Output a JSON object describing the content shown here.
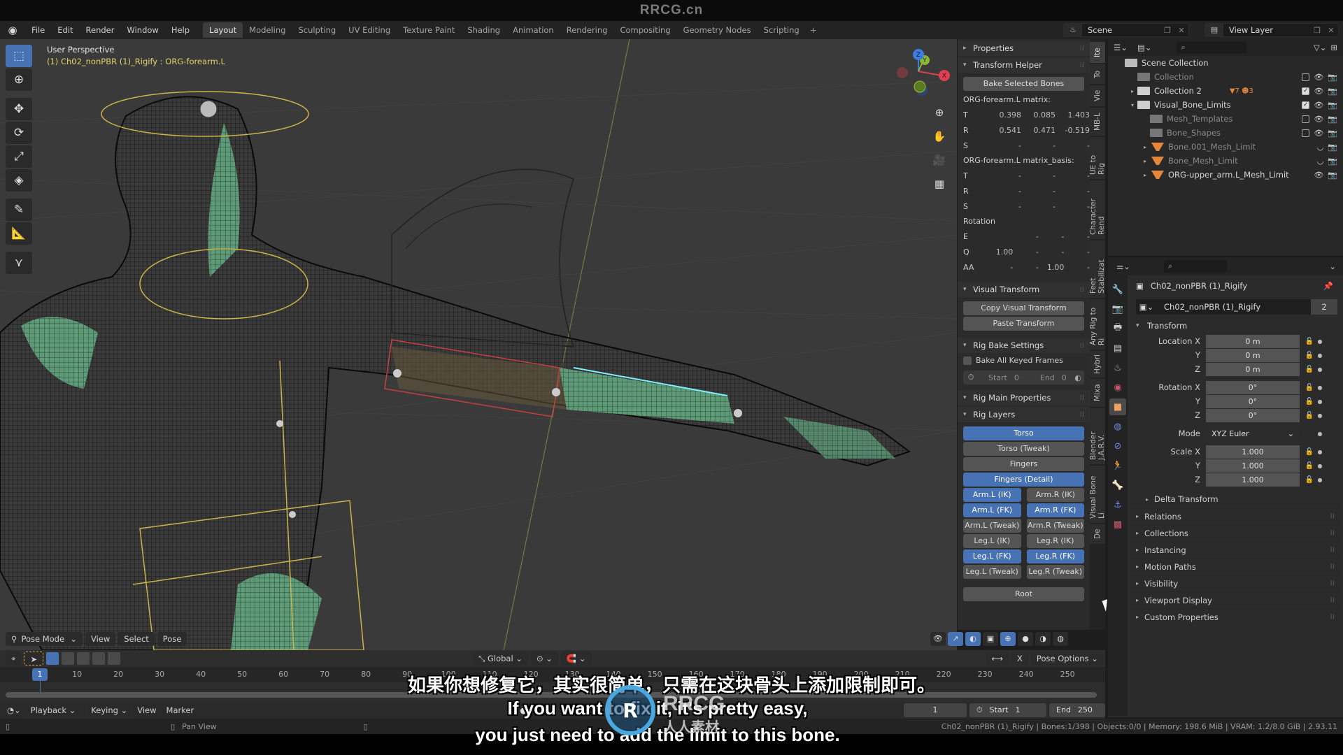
{
  "window": {
    "title": "RRCG.cn"
  },
  "menu": {
    "items": [
      "File",
      "Edit",
      "Render",
      "Window",
      "Help"
    ]
  },
  "workspaces": {
    "tabs": [
      "Layout",
      "Modeling",
      "Sculpting",
      "UV Editing",
      "Texture Paint",
      "Shading",
      "Animation",
      "Rendering",
      "Compositing",
      "Geometry Nodes",
      "Scripting"
    ],
    "active": "Layout",
    "add": "+"
  },
  "scene": {
    "name": "Scene",
    "view_layer": "View Layer"
  },
  "viewport": {
    "perspective": "User Perspective",
    "active_info": "(1) Ch02_nonPBR (1)_Rigify : ORG-forearm.L",
    "gizmo": {
      "x": "X",
      "y": "Y",
      "z": "Z",
      "colors": {
        "x": "#e0404f",
        "y": "#8ab835",
        "z": "#3d7fe0"
      }
    },
    "nav_buttons": [
      "zoom-icon",
      "hand-icon",
      "camera-icon",
      "grid-icon"
    ],
    "tools": [
      "select-box",
      "cursor",
      "move",
      "rotate",
      "scale",
      "transform",
      "annotate",
      "measure",
      "bone-roll"
    ],
    "header": {
      "mode": "Pose Mode",
      "menus": [
        "View",
        "Select",
        "Pose"
      ]
    },
    "toolbar": {
      "orientation": "Global",
      "pose_options": "Pose Options",
      "mirror_axis": "X"
    }
  },
  "npanel": {
    "sections": {
      "properties": "Properties",
      "transform_helper": "Transform Helper",
      "visual_transform": "Visual Transform",
      "rig_bake_settings": "Rig Bake Settings",
      "rig_main_properties": "Rig Main Properties",
      "rig_layers": "Rig Layers"
    },
    "bake_selected_bones": "Bake Selected Bones",
    "matrix_label": "ORG-forearm.L matrix:",
    "matrix": [
      {
        "k": "T",
        "v": [
          "0.398",
          "0.085",
          "1.403"
        ]
      },
      {
        "k": "R",
        "v": [
          "0.541",
          "0.471",
          "-0.519"
        ]
      },
      {
        "k": "S",
        "v": [
          "-",
          "-",
          "-"
        ]
      }
    ],
    "matrix_basis_label": "ORG-forearm.L matrix_basis:",
    "matrix_basis": [
      {
        "k": "T",
        "v": [
          "-",
          "-",
          "-"
        ]
      },
      {
        "k": "R",
        "v": [
          "-",
          "-",
          "-"
        ]
      },
      {
        "k": "S",
        "v": [
          "-",
          "-",
          "-"
        ]
      }
    ],
    "rotation_label": "Rotation",
    "rotation": [
      {
        "k": "E",
        "v": [
          "",
          "-",
          "-",
          "-"
        ]
      },
      {
        "k": "Q",
        "v": [
          "1.00",
          "-",
          "-",
          "-"
        ]
      },
      {
        "k": "AA",
        "v": [
          "-",
          "-",
          "1.00",
          "-"
        ]
      }
    ],
    "copy_visual_transform": "Copy Visual Transform",
    "paste_transform": "Paste Transform",
    "bake_all_keyed": "Bake All Keyed Frames",
    "bake_all_keyed_checked": false,
    "bake_start_label": "Start",
    "bake_start": "0",
    "bake_end_label": "End",
    "bake_end": "0",
    "rig_layers_full": [
      {
        "label": "Torso",
        "on": true
      },
      {
        "label": "Torso (Tweak)",
        "on": false
      },
      {
        "label": "Fingers",
        "on": false
      },
      {
        "label": "Fingers (Detail)",
        "on": true
      }
    ],
    "rig_layers_pairs": [
      [
        {
          "label": "Arm.L (IK)",
          "on": true
        },
        {
          "label": "Arm.R (IK)",
          "on": false
        }
      ],
      [
        {
          "label": "Arm.L (FK)",
          "on": true
        },
        {
          "label": "Arm.R (FK)",
          "on": true
        }
      ],
      [
        {
          "label": "Arm.L (Tweak)",
          "on": false
        },
        {
          "label": "Arm.R (Tweak)",
          "on": false
        }
      ],
      [
        {
          "label": "Leg.L (IK)",
          "on": false
        },
        {
          "label": "Leg.R (IK)",
          "on": false
        }
      ],
      [
        {
          "label": "Leg.L (FK)",
          "on": true
        },
        {
          "label": "Leg.R (FK)",
          "on": true
        }
      ],
      [
        {
          "label": "Leg.L (Tweak)",
          "on": false
        },
        {
          "label": "Leg.R (Tweak)",
          "on": false
        }
      ]
    ],
    "root": "Root"
  },
  "sidetabs": {
    "items": [
      "Ite",
      "To",
      "Vie",
      "MB-L",
      "UE to Rig",
      "Character Rend",
      "Feet Stabilizat",
      "Any Rig to Ri",
      "Hybri",
      "Mixa",
      "Blender J.A.R.V.",
      "Visual Bone Li",
      "De"
    ],
    "active": "Ite"
  },
  "outliner": {
    "search_placeholder": "",
    "rows": [
      {
        "label": "Scene Collection",
        "indent": 0,
        "type": "scene",
        "expand": "",
        "dim": false,
        "right": ""
      },
      {
        "label": "Collection",
        "indent": 1,
        "type": "coll",
        "expand": "",
        "dim": true,
        "checked": false
      },
      {
        "label": "Collection 2",
        "indent": 1,
        "type": "coll",
        "expand": "▸",
        "dim": false,
        "checked": true,
        "badges": [
          "7",
          "3"
        ]
      },
      {
        "label": "Visual_Bone_Limits",
        "indent": 1,
        "type": "coll",
        "expand": "▾",
        "dim": false,
        "checked": true
      },
      {
        "label": "Mesh_Templates",
        "indent": 2,
        "type": "coll",
        "expand": "",
        "dim": true,
        "checked": false
      },
      {
        "label": "Bone_Shapes",
        "indent": 2,
        "type": "coll",
        "expand": "",
        "dim": true,
        "checked": false
      },
      {
        "label": "Bone.001_Mesh_Limit",
        "indent": 2,
        "type": "mesh",
        "expand": "▸",
        "dim": true,
        "hidden": true
      },
      {
        "label": "Bone_Mesh_Limit",
        "indent": 2,
        "type": "mesh",
        "expand": "▸",
        "dim": true,
        "hidden": true
      },
      {
        "label": "ORG-upper_arm.L_Mesh_Limit",
        "indent": 2,
        "type": "mesh",
        "expand": "▸",
        "dim": false,
        "hidden": false
      }
    ]
  },
  "properties": {
    "object_name": "Ch02_nonPBR (1)_Rigify",
    "data_name": "Ch02_nonPBR (1)_Rigify",
    "users": "2",
    "transform_label": "Transform",
    "location": {
      "label": "Location X",
      "x": "0 m",
      "y": "0 m",
      "z": "0 m"
    },
    "rotation": {
      "label": "Rotation X",
      "x": "0°",
      "y": "0°",
      "z": "0°"
    },
    "mode_label": "Mode",
    "mode": "XYZ Euler",
    "scale": {
      "label": "Scale X",
      "x": "1.000",
      "y": "1.000",
      "z": "1.000"
    },
    "axis_y": "Y",
    "axis_z": "Z",
    "delta_transform": "Delta Transform",
    "collapsed_sections": [
      "Relations",
      "Collections",
      "Instancing",
      "Motion Paths",
      "Visibility",
      "Viewport Display",
      "Custom Properties"
    ]
  },
  "timeline": {
    "current_frame": "1",
    "ticks": [
      "10",
      "20",
      "30",
      "40",
      "50",
      "60",
      "70",
      "80",
      "90",
      "100",
      "110",
      "120",
      "130",
      "140",
      "150",
      "160",
      "170",
      "180",
      "190",
      "200",
      "210",
      "220",
      "230",
      "240",
      "250"
    ],
    "menus": [
      "Playback",
      "Keying",
      "View",
      "Marker"
    ],
    "frame_field": "1",
    "start_label": "Start",
    "start": "1",
    "end_label": "End",
    "end": "250"
  },
  "statusbar": {
    "hint": "Pan View",
    "info": "Ch02_nonPBR (1)_Rigify | Bones:1/398 | Objects:0/0 | Memory: 198.6 MiB | VRAM: 1.2/8.0 GiB | 2.93.11"
  },
  "subtitles": {
    "zh": "如果你想修复它，其实很简单，只需在这块骨头上添加限制即可。",
    "en1": "If you want to fix it, it's pretty easy,",
    "en2": "you just need to add the limit to this bone."
  },
  "watermark": {
    "text": "RRCG",
    "sub": "人人素材"
  }
}
